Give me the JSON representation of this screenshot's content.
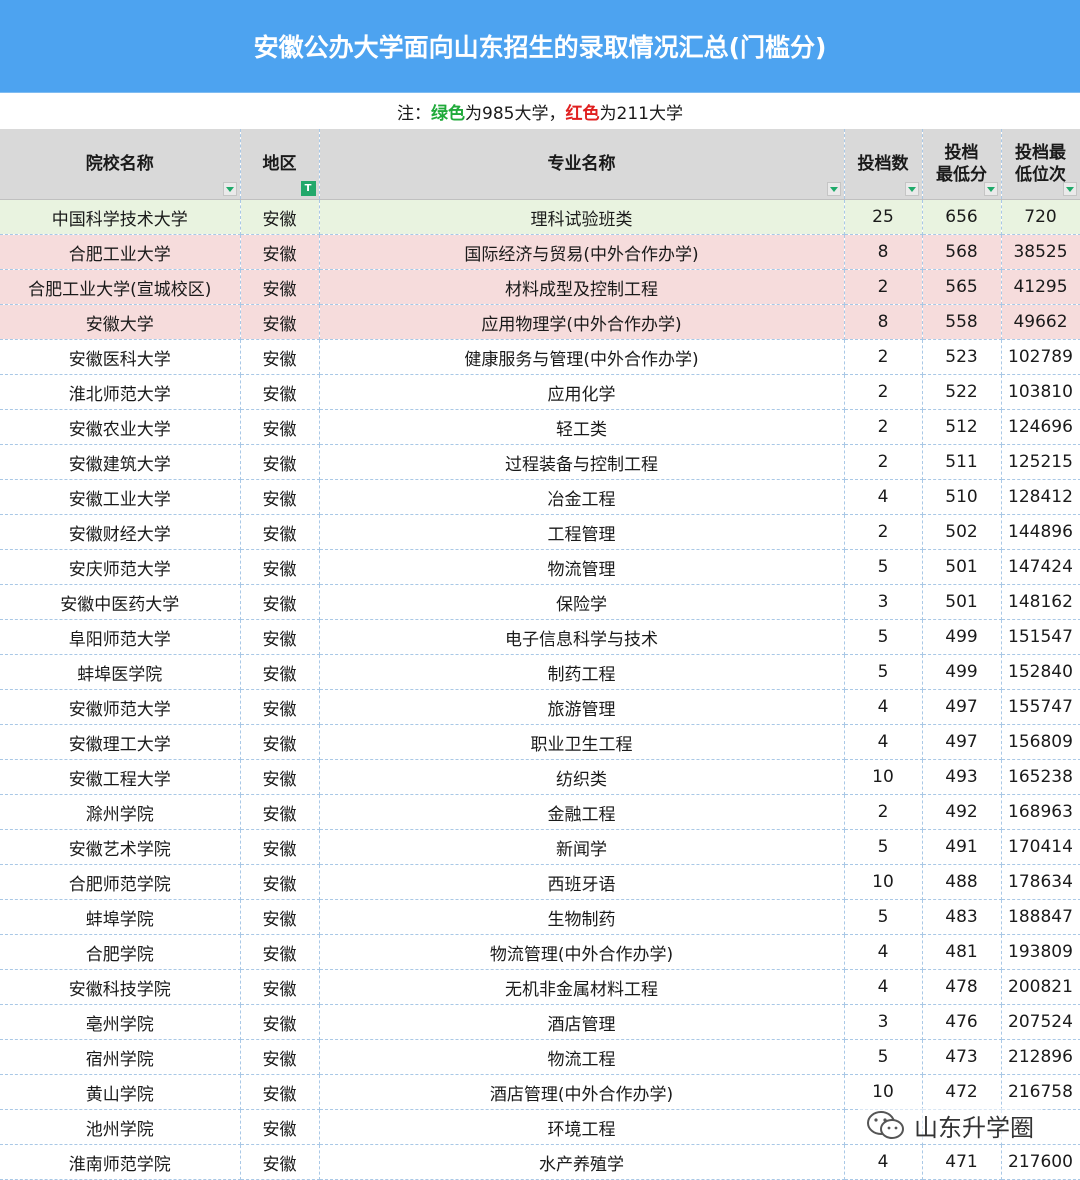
{
  "title": "安徽公办大学面向山东招生的录取情况汇总(门槛分)",
  "note": {
    "prefix": "注：",
    "green_word": "绿色",
    "green_desc": "为985大学，",
    "red_word": "红色",
    "red_desc": "为211大学"
  },
  "colors": {
    "title_bg": "#4da3f0",
    "green": "#1faa3a",
    "red": "#e02020",
    "green_row": "#e9f3e0",
    "red_row": "#f6dcdc"
  },
  "headers": {
    "school": "院校名称",
    "region": "地区",
    "major": "专业名称",
    "count": "投档数",
    "min_score_1": "投档",
    "min_score_2": "最低分",
    "min_rank_1": "投档最",
    "min_rank_2": "低位次"
  },
  "rows": [
    {
      "school": "中国科学技术大学",
      "region": "安徽",
      "major": "理科试验班类",
      "count": "25",
      "score": "656",
      "rank": "720",
      "tier": "985"
    },
    {
      "school": "合肥工业大学",
      "region": "安徽",
      "major": "国际经济与贸易(中外合作办学)",
      "count": "8",
      "score": "568",
      "rank": "38525",
      "tier": "211"
    },
    {
      "school": "合肥工业大学(宣城校区)",
      "region": "安徽",
      "major": "材料成型及控制工程",
      "count": "2",
      "score": "565",
      "rank": "41295",
      "tier": "211"
    },
    {
      "school": "安徽大学",
      "region": "安徽",
      "major": "应用物理学(中外合作办学)",
      "count": "8",
      "score": "558",
      "rank": "49662",
      "tier": "211"
    },
    {
      "school": "安徽医科大学",
      "region": "安徽",
      "major": "健康服务与管理(中外合作办学)",
      "count": "2",
      "score": "523",
      "rank": "102789",
      "tier": ""
    },
    {
      "school": "淮北师范大学",
      "region": "安徽",
      "major": "应用化学",
      "count": "2",
      "score": "522",
      "rank": "103810",
      "tier": ""
    },
    {
      "school": "安徽农业大学",
      "region": "安徽",
      "major": "轻工类",
      "count": "2",
      "score": "512",
      "rank": "124696",
      "tier": ""
    },
    {
      "school": "安徽建筑大学",
      "region": "安徽",
      "major": "过程装备与控制工程",
      "count": "2",
      "score": "511",
      "rank": "125215",
      "tier": ""
    },
    {
      "school": "安徽工业大学",
      "region": "安徽",
      "major": "冶金工程",
      "count": "4",
      "score": "510",
      "rank": "128412",
      "tier": ""
    },
    {
      "school": "安徽财经大学",
      "region": "安徽",
      "major": "工程管理",
      "count": "2",
      "score": "502",
      "rank": "144896",
      "tier": ""
    },
    {
      "school": "安庆师范大学",
      "region": "安徽",
      "major": "物流管理",
      "count": "5",
      "score": "501",
      "rank": "147424",
      "tier": ""
    },
    {
      "school": "安徽中医药大学",
      "region": "安徽",
      "major": "保险学",
      "count": "3",
      "score": "501",
      "rank": "148162",
      "tier": ""
    },
    {
      "school": "阜阳师范大学",
      "region": "安徽",
      "major": "电子信息科学与技术",
      "count": "5",
      "score": "499",
      "rank": "151547",
      "tier": ""
    },
    {
      "school": "蚌埠医学院",
      "region": "安徽",
      "major": "制药工程",
      "count": "5",
      "score": "499",
      "rank": "152840",
      "tier": ""
    },
    {
      "school": "安徽师范大学",
      "region": "安徽",
      "major": "旅游管理",
      "count": "4",
      "score": "497",
      "rank": "155747",
      "tier": ""
    },
    {
      "school": "安徽理工大学",
      "region": "安徽",
      "major": "职业卫生工程",
      "count": "4",
      "score": "497",
      "rank": "156809",
      "tier": ""
    },
    {
      "school": "安徽工程大学",
      "region": "安徽",
      "major": "纺织类",
      "count": "10",
      "score": "493",
      "rank": "165238",
      "tier": ""
    },
    {
      "school": "滁州学院",
      "region": "安徽",
      "major": "金融工程",
      "count": "2",
      "score": "492",
      "rank": "168963",
      "tier": ""
    },
    {
      "school": "安徽艺术学院",
      "region": "安徽",
      "major": "新闻学",
      "count": "5",
      "score": "491",
      "rank": "170414",
      "tier": ""
    },
    {
      "school": "合肥师范学院",
      "region": "安徽",
      "major": "西班牙语",
      "count": "10",
      "score": "488",
      "rank": "178634",
      "tier": ""
    },
    {
      "school": "蚌埠学院",
      "region": "安徽",
      "major": "生物制药",
      "count": "5",
      "score": "483",
      "rank": "188847",
      "tier": ""
    },
    {
      "school": "合肥学院",
      "region": "安徽",
      "major": "物流管理(中外合作办学)",
      "count": "4",
      "score": "481",
      "rank": "193809",
      "tier": ""
    },
    {
      "school": "安徽科技学院",
      "region": "安徽",
      "major": "无机非金属材料工程",
      "count": "4",
      "score": "478",
      "rank": "200821",
      "tier": ""
    },
    {
      "school": "亳州学院",
      "region": "安徽",
      "major": "酒店管理",
      "count": "3",
      "score": "476",
      "rank": "207524",
      "tier": ""
    },
    {
      "school": "宿州学院",
      "region": "安徽",
      "major": "物流工程",
      "count": "5",
      "score": "473",
      "rank": "212896",
      "tier": ""
    },
    {
      "school": "黄山学院",
      "region": "安徽",
      "major": "酒店管理(中外合作办学)",
      "count": "10",
      "score": "472",
      "rank": "216758",
      "tier": ""
    },
    {
      "school": "池州学院",
      "region": "安徽",
      "major": "环境工程",
      "count": "",
      "score": "",
      "rank": "",
      "tier": ""
    },
    {
      "school": "淮南师范学院",
      "region": "安徽",
      "major": "水产养殖学",
      "count": "4",
      "score": "471",
      "rank": "217600",
      "tier": ""
    }
  ],
  "watermark": {
    "icon": "wechat-icon",
    "text": "山东升学圈"
  }
}
